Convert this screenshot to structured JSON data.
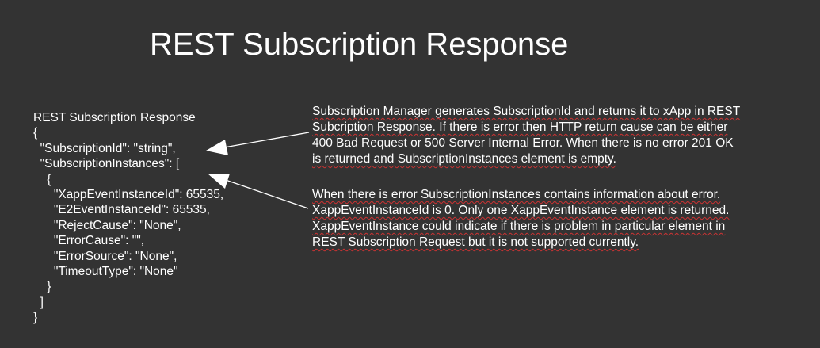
{
  "slide": {
    "title": "REST Subscription Response"
  },
  "code": {
    "lines": [
      "REST Subscription Response",
      "{",
      "  \"SubscriptionId\": \"string\",",
      "  \"SubscriptionInstances\": [",
      "    {",
      "      \"XappEventInstanceId\": 65535,",
      "      \"E2EventInstanceId\": 65535,",
      "      \"RejectCause\": \"None\",",
      "      \"ErrorCause\": \"\",",
      "      \"ErrorSource\": \"None\",",
      "      \"TimeoutType\": \"None\"",
      "    }",
      "  ]",
      "}"
    ]
  },
  "notes": [
    {
      "lines": [
        "Subscription Manager generates SubscriptionId and returns it to xApp in REST",
        "Subcription Response. If there is error then HTTP return cause can be either",
        "400 Bad Request or 500 Server Internal Error. When there is no error 201 OK",
        "is returned and SubscriptionInstances element is empty."
      ]
    },
    {
      "lines": [
        "When there is error SubscriptionInstances contains information about error.",
        "XappEventInstanceId is 0. Only one XappEventInstance element is returned.",
        "XappEventInstance could indicate if there is problem in particular element in",
        "REST Subscription Request but it is not supported currently."
      ]
    }
  ]
}
